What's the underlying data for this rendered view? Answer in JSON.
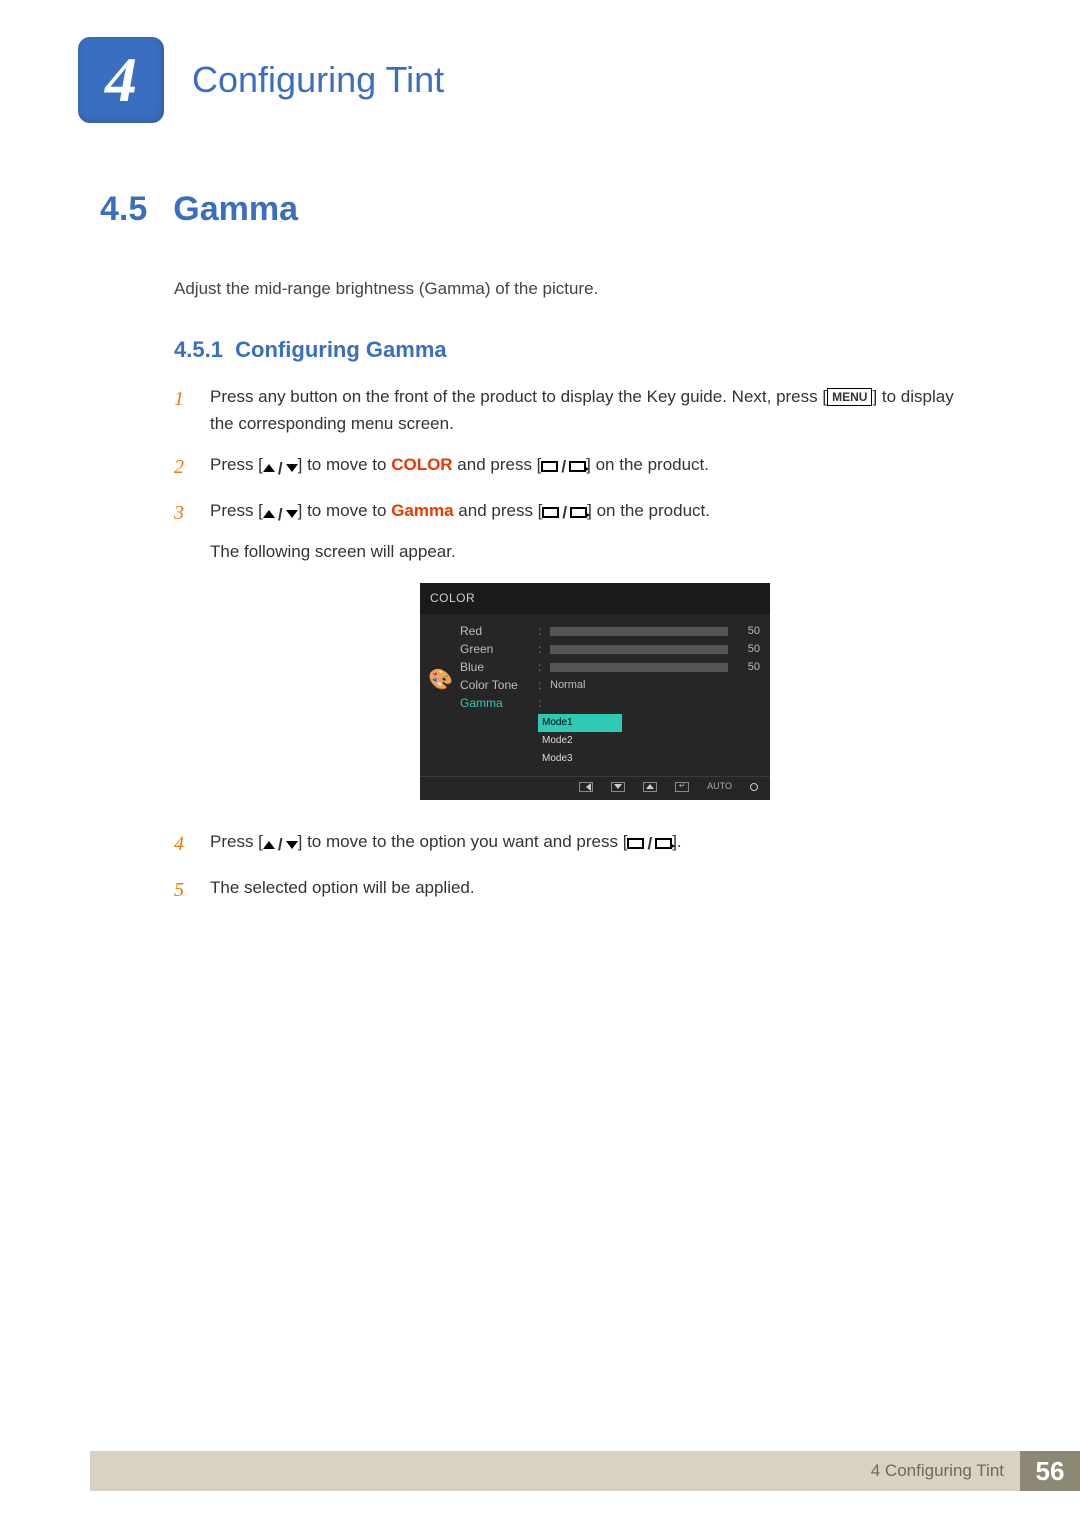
{
  "chapter": {
    "number": "4",
    "title": "Configuring Tint"
  },
  "section": {
    "number": "4.5",
    "title": "Gamma"
  },
  "description": "Adjust the mid-range brightness (Gamma) of the picture.",
  "subsection": {
    "number": "4.5.1",
    "title": "Configuring Gamma"
  },
  "steps": {
    "s1": {
      "n": "1",
      "pre": "Press any button on the front of the product to display the Key guide. Next, press [",
      "menu": "MENU",
      "post": "] to display the corresponding menu screen."
    },
    "s2": {
      "n": "2",
      "pre": "Press [",
      "mid": "] to move to ",
      "kw": "COLOR",
      "post": " and press [",
      "end": "] on the product."
    },
    "s3": {
      "n": "3",
      "pre": "Press [",
      "mid": "] to move to ",
      "kw": "Gamma",
      "post": " and press [",
      "end": "] on the product.",
      "note": "The following screen will appear."
    },
    "s4": {
      "n": "4",
      "pre": "Press [",
      "mid": "] to move to the option you want and press [",
      "end": "]."
    },
    "s5": {
      "n": "5",
      "text": "The selected option will be applied."
    }
  },
  "osd": {
    "title": "COLOR",
    "rows": {
      "red": {
        "label": "Red",
        "value": "50"
      },
      "green": {
        "label": "Green",
        "value": "50"
      },
      "blue": {
        "label": "Blue",
        "value": "50"
      },
      "tone": {
        "label": "Color Tone",
        "value": "Normal"
      },
      "gamma": {
        "label": "Gamma"
      }
    },
    "options": {
      "o1": "Mode1",
      "o2": "Mode2",
      "o3": "Mode3"
    },
    "nav_auto": "AUTO"
  },
  "footer": {
    "label": "4 Configuring Tint",
    "page": "56"
  }
}
